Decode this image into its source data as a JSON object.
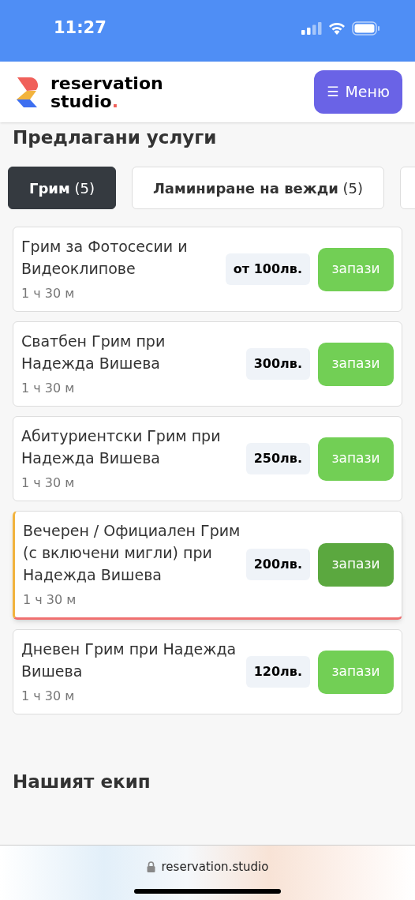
{
  "status_bar": {
    "time": "11:27"
  },
  "header": {
    "logo": {
      "line1": "reservation",
      "line2": "studio",
      "dot": "."
    },
    "menu_button": {
      "icon": "☰",
      "label": "Меню"
    }
  },
  "services": {
    "title": "Предлагани услуги",
    "tabs": [
      {
        "label": "Грим",
        "count": "(5)",
        "selected": true
      },
      {
        "label": "Ламиниране на вежди",
        "count": "(5)",
        "selected": false
      }
    ],
    "items": [
      {
        "name": "Грим за Фотосесии и Видеоклипове",
        "duration": "1 ч 30 м",
        "price": "от 100лв.",
        "button": "запази",
        "selected": false
      },
      {
        "name": "Сватбен Грим при Надежда Вишева",
        "duration": "1 ч 30 м",
        "price": "300лв.",
        "button": "запази",
        "selected": false
      },
      {
        "name": "Абитуриентски Грим при Надежда Вишева",
        "duration": "1 ч 30 м",
        "price": "250лв.",
        "button": "запази",
        "selected": false
      },
      {
        "name": "Вечерен / Официален Грим (с включени мигли) при Надежда Вишева",
        "duration": "1 ч 30 м",
        "price": "200лв.",
        "button": "запази",
        "selected": true
      },
      {
        "name": "Дневен Грим при Надежда Вишева",
        "duration": "1 ч 30 м",
        "price": "120лв.",
        "button": "запази",
        "selected": false
      }
    ]
  },
  "team": {
    "title": "Нашият екип"
  },
  "browser_bar": {
    "url": "reservation.studio"
  }
}
